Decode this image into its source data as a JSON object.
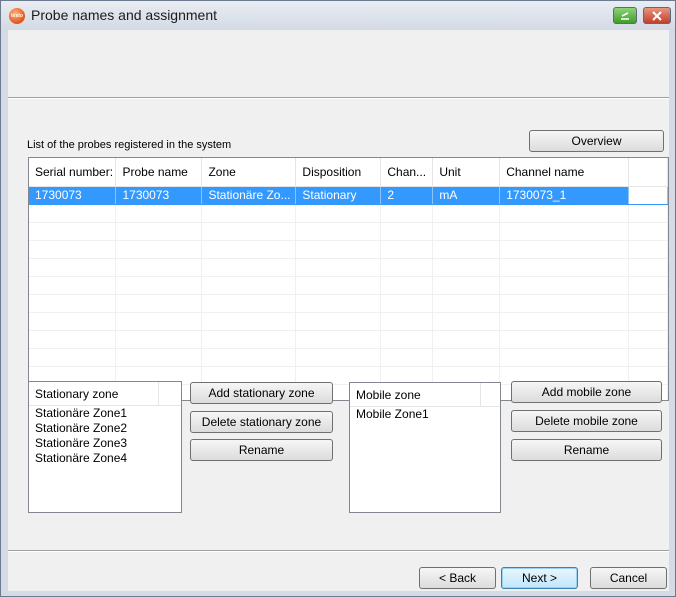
{
  "window": {
    "title": "Probe names and assignment",
    "app_icon_label": "testo"
  },
  "list": {
    "caption": "List of the probes registered in the system",
    "overview_label": "Overview",
    "columns": [
      "Serial number:",
      "Probe name",
      "Zone",
      "Disposition",
      "Chan...",
      "Unit",
      "Channel name"
    ],
    "rows": [
      [
        "1730073",
        "1730073",
        "Stationäre Zo...",
        "Stationary",
        "2",
        "mA",
        "1730073_1"
      ]
    ]
  },
  "stationary": {
    "header": "Stationary zone",
    "items": [
      "Stationäre Zone1",
      "Stationäre Zone2",
      "Stationäre Zone3",
      "Stationäre Zone4"
    ],
    "add_label": "Add stationary zone",
    "delete_label": "Delete stationary zone",
    "rename_label": "Rename"
  },
  "mobile": {
    "header": "Mobile zone",
    "items": [
      "Mobile Zone1"
    ],
    "add_label": "Add mobile zone",
    "delete_label": "Delete mobile zone",
    "rename_label": "Rename"
  },
  "footer": {
    "back_label": "< Back",
    "next_label": "Next >",
    "cancel_label": "Cancel"
  },
  "colors": {
    "selection": "#3399ff",
    "frame": "#d5dbe4",
    "client": "#f0f0f0"
  }
}
